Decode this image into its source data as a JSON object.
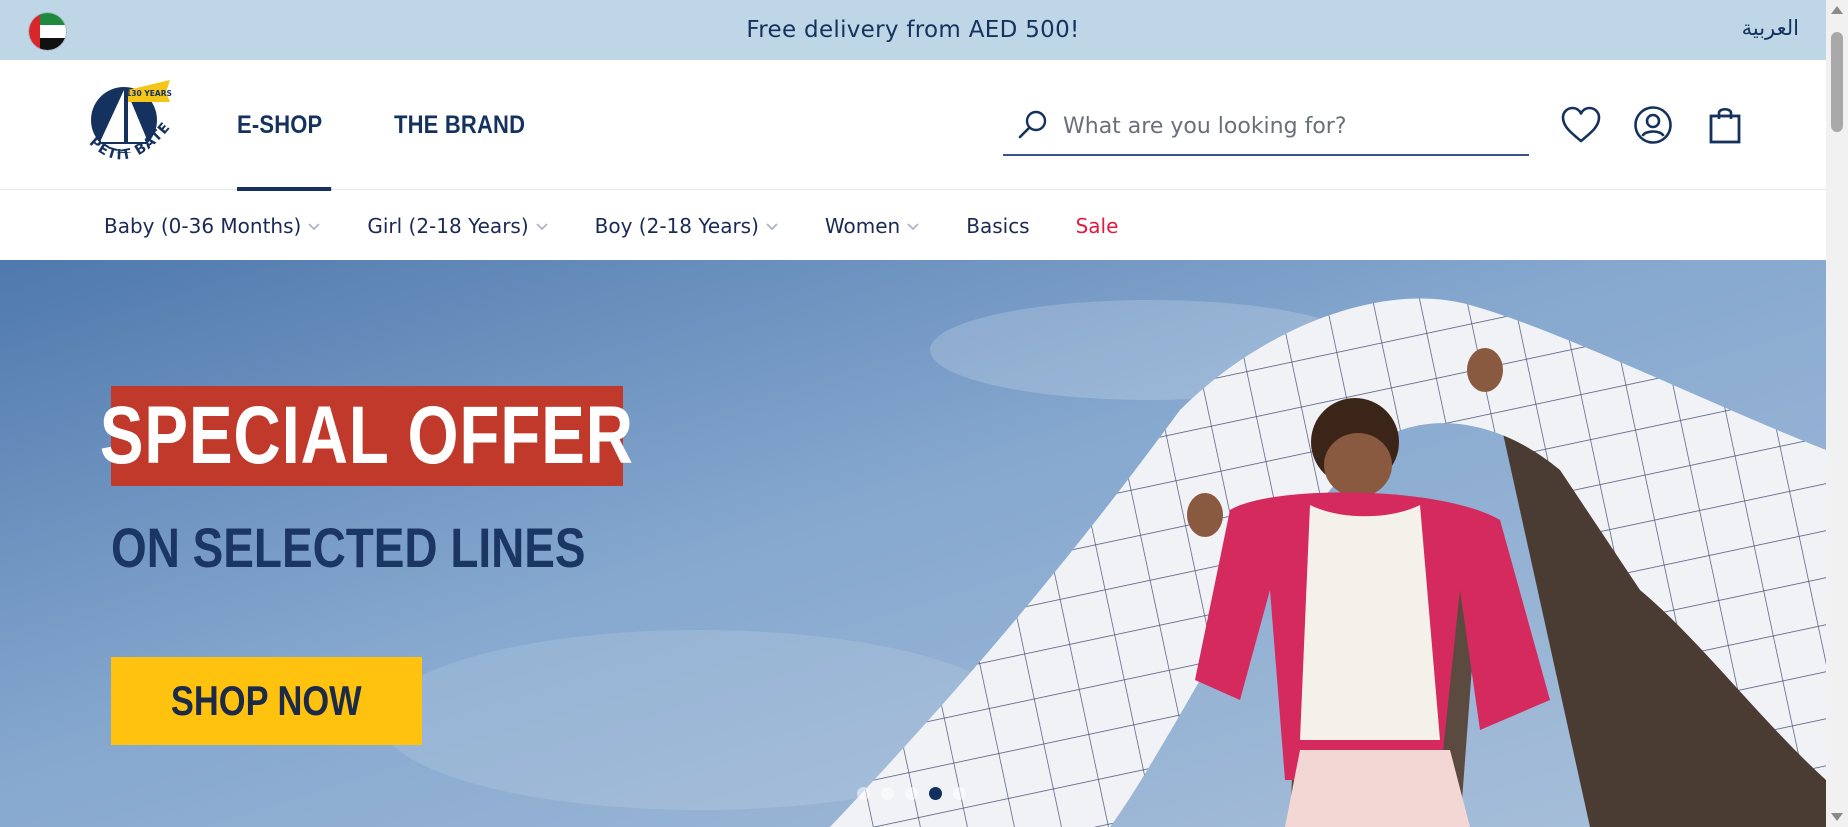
{
  "topbar": {
    "announcement": "Free delivery from AED 500!",
    "language": "العربية",
    "flag_icon": "uae-flag-icon"
  },
  "header": {
    "logo_text": "PETIT BATEAU",
    "logo_badge": "130 YEARS",
    "nav": [
      {
        "label": "E-SHOP",
        "active": true
      },
      {
        "label": "THE BRAND",
        "active": false
      }
    ],
    "search_placeholder": "What are you looking for?",
    "icons": [
      "wishlist-heart-icon",
      "account-user-icon",
      "shopping-bag-icon"
    ]
  },
  "categories": [
    {
      "label": "Baby (0-36 Months)",
      "has_dropdown": true
    },
    {
      "label": "Girl (2-18 Years)",
      "has_dropdown": true
    },
    {
      "label": "Boy (2-18 Years)",
      "has_dropdown": true
    },
    {
      "label": "Women",
      "has_dropdown": true
    },
    {
      "label": "Basics",
      "has_dropdown": false
    },
    {
      "label": "Sale",
      "has_dropdown": false
    }
  ],
  "hero": {
    "title": "SPECIAL OFFER",
    "subtitle": "ON SELECTED LINES",
    "cta": "SHOP NOW",
    "slides_count": 5,
    "active_slide": 4
  },
  "colors": {
    "navy": "#15325f",
    "topbar_bg": "#bfd6e6",
    "offer_red": "#c0392b",
    "cta_yellow": "#ffc20e",
    "sale_red": "#e01b3c"
  }
}
